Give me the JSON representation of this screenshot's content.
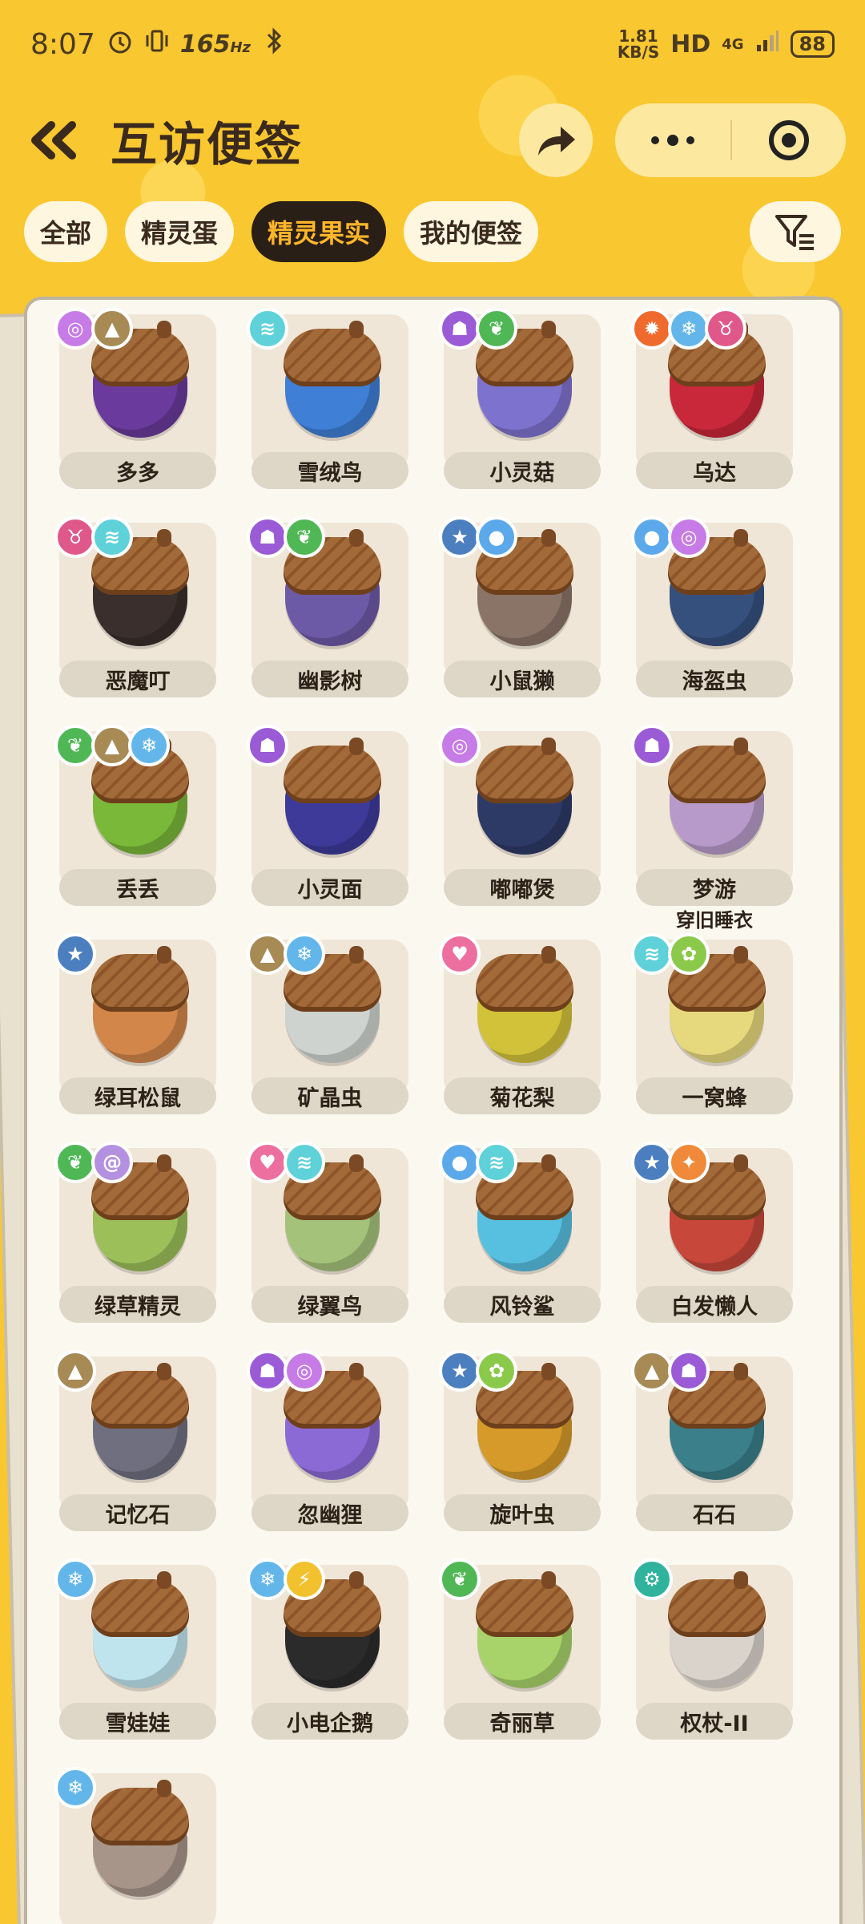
{
  "status_bar": {
    "time": "8:07",
    "refresh_rate": "165",
    "refresh_unit": "Hz",
    "net_speed_value": "1.81",
    "net_speed_unit": "KB/S",
    "hd": "HD",
    "network": "4G",
    "battery": "88"
  },
  "header": {
    "title": "互访便签"
  },
  "tabs": [
    {
      "label": "全部",
      "active": false
    },
    {
      "label": "精灵蛋",
      "active": false
    },
    {
      "label": "精灵果实",
      "active": true
    },
    {
      "label": "我的便签",
      "active": false
    }
  ],
  "colors": {
    "background": "#f9c72f",
    "tab_active_bg": "#2a1f16",
    "tab_active_text": "#ffb62a",
    "card_bg": "#fbf8f0"
  },
  "fruits": [
    {
      "name": "多多",
      "nut_color": "#6a3a9c",
      "badges": [
        {
          "icon": "psychic-icon",
          "color": "#c77be6"
        },
        {
          "icon": "mountain-icon",
          "color": "#a88a55"
        }
      ]
    },
    {
      "name": "雪绒鸟",
      "nut_color": "#3f7fd6",
      "badges": [
        {
          "icon": "wing-icon",
          "color": "#5ed1d9"
        }
      ]
    },
    {
      "name": "小灵菇",
      "nut_color": "#7e72cf",
      "badges": [
        {
          "icon": "ghost-icon",
          "color": "#9b5ad6"
        },
        {
          "icon": "leaf-icon",
          "color": "#4fb855"
        }
      ]
    },
    {
      "name": "乌达",
      "nut_color": "#c9283a",
      "badges": [
        {
          "icon": "fire-icon",
          "color": "#f06a2d"
        },
        {
          "icon": "ice-icon",
          "color": "#63b6ea"
        },
        {
          "icon": "demon-icon",
          "color": "#e05889"
        }
      ]
    },
    {
      "name": "恶魔叮",
      "nut_color": "#3a2f2c",
      "badges": [
        {
          "icon": "demon-icon",
          "color": "#e05889"
        },
        {
          "icon": "wing-icon",
          "color": "#5ed1d9"
        }
      ]
    },
    {
      "name": "幽影树",
      "nut_color": "#6d5aa6",
      "badges": [
        {
          "icon": "ghost-icon",
          "color": "#9b5ad6"
        },
        {
          "icon": "leaf-icon",
          "color": "#4fb855"
        }
      ]
    },
    {
      "name": "小鼠獭",
      "nut_color": "#8a7468",
      "badges": [
        {
          "icon": "normal-icon",
          "color": "#4c7fbf"
        },
        {
          "icon": "water-icon",
          "color": "#5ba9ea"
        }
      ]
    },
    {
      "name": "海盔虫",
      "nut_color": "#36507e",
      "badges": [
        {
          "icon": "water-icon",
          "color": "#5ba9ea"
        },
        {
          "icon": "psychic-icon",
          "color": "#c77be6"
        }
      ]
    },
    {
      "name": "丢丢",
      "nut_color": "#7ab83a",
      "badges": [
        {
          "icon": "leaf-icon",
          "color": "#4fb855"
        },
        {
          "icon": "mountain-icon",
          "color": "#a88a55"
        },
        {
          "icon": "ice-icon",
          "color": "#63b6ea"
        }
      ]
    },
    {
      "name": "小灵面",
      "nut_color": "#3d3a9a",
      "badges": [
        {
          "icon": "ghost-icon",
          "color": "#9b5ad6"
        }
      ]
    },
    {
      "name": "嘟嘟煲",
      "nut_color": "#2e3a66",
      "badges": [
        {
          "icon": "psychic-icon",
          "color": "#c77be6"
        }
      ]
    },
    {
      "name": "梦游",
      "nut_color": "#b79ac9",
      "badges": [
        {
          "icon": "ghost-icon",
          "color": "#9b5ad6"
        }
      ]
    },
    {
      "name": "绿耳松鼠",
      "nut_color": "#d2864a",
      "badges": [
        {
          "icon": "normal-icon",
          "color": "#4c7fbf"
        }
      ]
    },
    {
      "name": "矿晶虫",
      "nut_color": "#cfd3cf",
      "badges": [
        {
          "icon": "mountain-icon",
          "color": "#a88a55"
        },
        {
          "icon": "ice-icon",
          "color": "#63b6ea"
        }
      ]
    },
    {
      "name": "菊花梨",
      "nut_color": "#d2c23a",
      "badges": [
        {
          "icon": "heart-icon",
          "color": "#ec6f9f"
        }
      ]
    },
    {
      "name": "一窝蜂",
      "nut_color": "#e6d87c",
      "badges": [
        {
          "icon": "wing-icon",
          "color": "#5ed1d9"
        },
        {
          "icon": "bug-icon",
          "color": "#8bc94a"
        }
      ],
      "note": "穿旧睡衣"
    },
    {
      "name": "绿草精灵",
      "nut_color": "#9cbf5a",
      "badges": [
        {
          "icon": "leaf-icon",
          "color": "#4fb855"
        },
        {
          "icon": "spiral-icon",
          "color": "#b490e0"
        }
      ]
    },
    {
      "name": "绿翼鸟",
      "nut_color": "#a5c27a",
      "badges": [
        {
          "icon": "heart-icon",
          "color": "#ec6f9f"
        },
        {
          "icon": "wing-icon",
          "color": "#5ed1d9"
        }
      ]
    },
    {
      "name": "风铃鲨",
      "nut_color": "#57bfe0",
      "badges": [
        {
          "icon": "water-icon",
          "color": "#5ba9ea"
        },
        {
          "icon": "wing-icon",
          "color": "#5ed1d9"
        }
      ]
    },
    {
      "name": "白发懒人",
      "nut_color": "#c7473a",
      "badges": [
        {
          "icon": "normal-icon",
          "color": "#4c7fbf"
        },
        {
          "icon": "badge-icon",
          "color": "#f08a3a"
        }
      ]
    },
    {
      "name": "记忆石",
      "nut_color": "#6f6f80",
      "badges": [
        {
          "icon": "mountain-icon",
          "color": "#a88a55"
        }
      ]
    },
    {
      "name": "忽幽狸",
      "nut_color": "#8c6ad6",
      "badges": [
        {
          "icon": "ghost-icon",
          "color": "#9b5ad6"
        },
        {
          "icon": "psychic-icon",
          "color": "#c77be6"
        }
      ]
    },
    {
      "name": "旋叶虫",
      "nut_color": "#d69a2a",
      "badges": [
        {
          "icon": "normal-icon",
          "color": "#4c7fbf"
        },
        {
          "icon": "bug-icon",
          "color": "#8bc94a"
        }
      ]
    },
    {
      "name": "石石",
      "nut_color": "#3b7f8a",
      "badges": [
        {
          "icon": "mountain-icon",
          "color": "#a88a55"
        },
        {
          "icon": "ghost-icon",
          "color": "#9b5ad6"
        }
      ]
    },
    {
      "name": "雪娃娃",
      "nut_color": "#bfe4ee",
      "badges": [
        {
          "icon": "ice-icon",
          "color": "#63b6ea"
        }
      ]
    },
    {
      "name": "小电企鹅",
      "nut_color": "#2b2b2b",
      "badges": [
        {
          "icon": "ice-icon",
          "color": "#63b6ea"
        },
        {
          "icon": "electric-icon",
          "color": "#f2c12e"
        }
      ]
    },
    {
      "name": "奇丽草",
      "nut_color": "#a8d36a",
      "badges": [
        {
          "icon": "leaf-icon",
          "color": "#4fb855"
        }
      ]
    },
    {
      "name": "权杖-II",
      "nut_color": "#d9d3cc",
      "badges": [
        {
          "icon": "gear-icon",
          "color": "#2fb39c"
        }
      ]
    },
    {
      "name": "",
      "nut_color": "#a8958a",
      "badges": [
        {
          "icon": "ice-icon",
          "color": "#63b6ea"
        }
      ]
    }
  ]
}
